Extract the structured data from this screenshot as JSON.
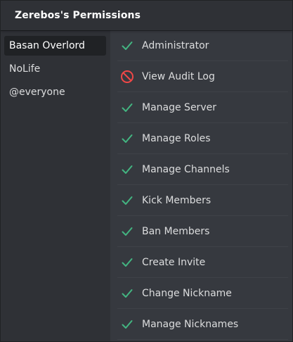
{
  "window": {
    "title": "Zerebos's Permissions"
  },
  "colors": {
    "allowed": "#43b581",
    "denied": "#f04747",
    "selected_role_bg": "#202225"
  },
  "roles": [
    {
      "label": "Basan Overlord",
      "selected": true
    },
    {
      "label": "NoLife",
      "selected": false
    },
    {
      "label": "@everyone",
      "selected": false
    }
  ],
  "permissions": [
    {
      "label": "Administrator",
      "icon": "check-icon"
    },
    {
      "label": "View Audit Log",
      "icon": "denied-icon"
    },
    {
      "label": "Manage Server",
      "icon": "check-icon"
    },
    {
      "label": "Manage Roles",
      "icon": "check-icon"
    },
    {
      "label": "Manage Channels",
      "icon": "check-icon"
    },
    {
      "label": "Kick Members",
      "icon": "check-icon"
    },
    {
      "label": "Ban Members",
      "icon": "check-icon"
    },
    {
      "label": "Create Invite",
      "icon": "check-icon"
    },
    {
      "label": "Change Nickname",
      "icon": "check-icon"
    },
    {
      "label": "Manage Nicknames",
      "icon": "check-icon"
    }
  ]
}
